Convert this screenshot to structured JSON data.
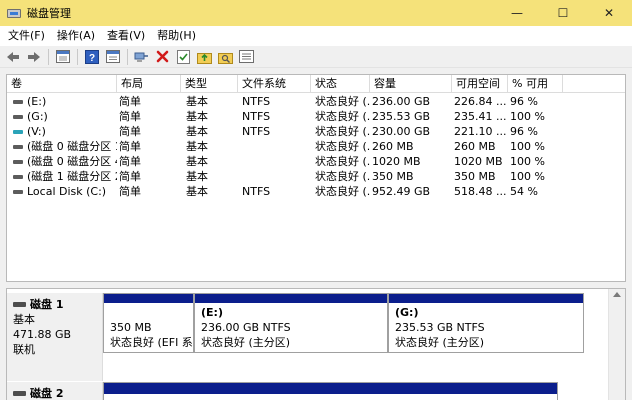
{
  "window": {
    "title": "磁盘管理",
    "controls": {
      "minimize": "—",
      "maximize": "☐",
      "close": "✕"
    }
  },
  "menu": [
    "文件(F)",
    "操作(A)",
    "查看(V)",
    "帮助(H)"
  ],
  "toolbar_icons": [
    "back-arrow-icon",
    "forward-arrow-icon",
    "console-icon",
    "help-icon",
    "properties-icon",
    "connect-icon",
    "delete-icon",
    "checklist-icon",
    "folder-up-icon",
    "folder-search-icon",
    "settings-list-icon"
  ],
  "colors": {
    "titlebar": "#f5e27a",
    "partition_bar": "#0b1e8c",
    "teal_drive": "#2aa3b8"
  },
  "volume_list": {
    "columns": [
      "卷",
      "布局",
      "类型",
      "文件系统",
      "状态",
      "容量",
      "可用空间",
      "% 可用"
    ],
    "rows": [
      {
        "vol": "(E:)",
        "layout": "简单",
        "type": "基本",
        "fs": "NTFS",
        "status": "状态良好 (...",
        "cap": "236.00 GB",
        "free": "226.84 ...",
        "pct": "96 %",
        "teal": false
      },
      {
        "vol": "(G:)",
        "layout": "简单",
        "type": "基本",
        "fs": "NTFS",
        "status": "状态良好 (...",
        "cap": "235.53 GB",
        "free": "235.41 ...",
        "pct": "100 %",
        "teal": false
      },
      {
        "vol": "(V:)",
        "layout": "简单",
        "type": "基本",
        "fs": "NTFS",
        "status": "状态良好 (...",
        "cap": "230.00 GB",
        "free": "221.10 ...",
        "pct": "96 %",
        "teal": true
      },
      {
        "vol": "(磁盘 0 磁盘分区 1)",
        "layout": "简单",
        "type": "基本",
        "fs": "",
        "status": "状态良好 (...",
        "cap": "260 MB",
        "free": "260 MB",
        "pct": "100 %",
        "teal": false
      },
      {
        "vol": "(磁盘 0 磁盘分区 4)",
        "layout": "简单",
        "type": "基本",
        "fs": "",
        "status": "状态良好 (...",
        "cap": "1020 MB",
        "free": "1020 MB",
        "pct": "100 %",
        "teal": false
      },
      {
        "vol": "(磁盘 1 磁盘分区 2)",
        "layout": "简单",
        "type": "基本",
        "fs": "",
        "status": "状态良好 (...",
        "cap": "350 MB",
        "free": "350 MB",
        "pct": "100 %",
        "teal": false
      },
      {
        "vol": "Local Disk (C:)",
        "layout": "简单",
        "type": "基本",
        "fs": "NTFS",
        "status": "状态良好 (...",
        "cap": "952.49 GB",
        "free": "518.48 ...",
        "pct": "54 %",
        "teal": false
      }
    ]
  },
  "disks": [
    {
      "name": "磁盘 1",
      "type": "基本",
      "size": "471.88 GB",
      "state": "联机",
      "partitions": [
        {
          "label": "",
          "size": "350 MB",
          "status": "状态良好 (EFI 系统"
        },
        {
          "label": "(E:)",
          "size": "236.00 GB NTFS",
          "status": "状态良好 (主分区)"
        },
        {
          "label": "(G:)",
          "size": "235.53 GB NTFS",
          "status": "状态良好 (主分区)"
        }
      ]
    },
    {
      "name": "磁盘 2"
    }
  ]
}
